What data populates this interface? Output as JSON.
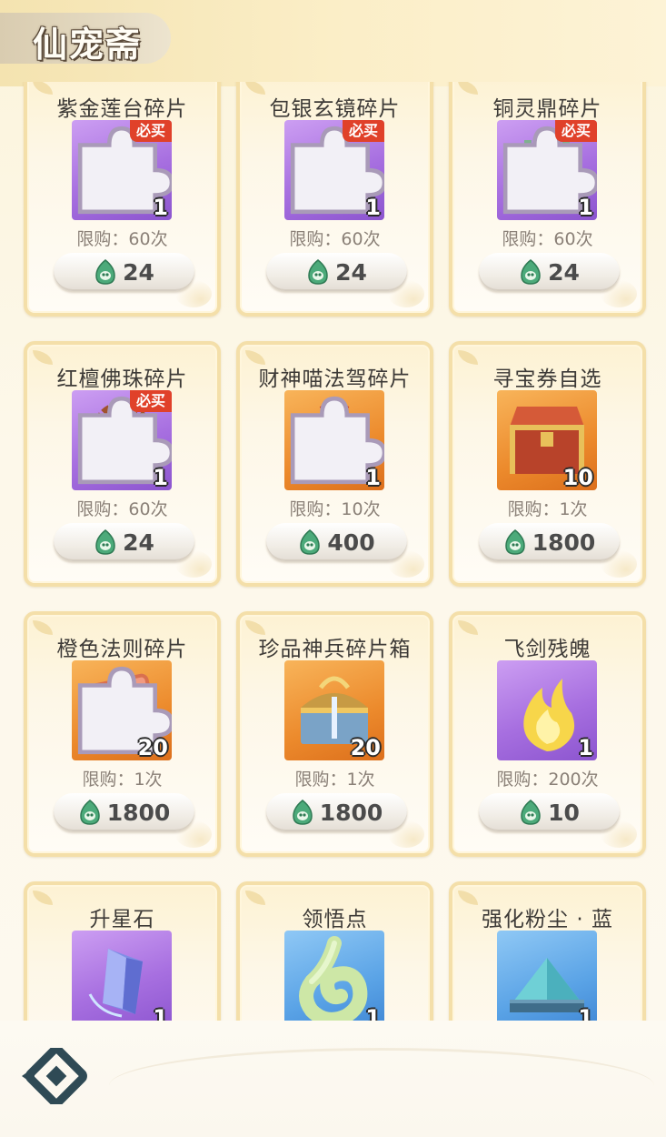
{
  "header": {
    "title": "仙宠斋"
  },
  "colors": {
    "accent_red": "#e0412a",
    "card_border": "#f4dfa9"
  },
  "items": [
    {
      "name": "紫金莲台碎片",
      "qty": "1",
      "limit": "限购：60次",
      "price": "24",
      "badge": "必买",
      "fragment": true,
      "bg": "purple",
      "icon": "lotus-icon"
    },
    {
      "name": "包银玄镜碎片",
      "qty": "1",
      "limit": "限购：60次",
      "price": "24",
      "badge": "必买",
      "fragment": true,
      "bg": "purple",
      "icon": "mirror-icon"
    },
    {
      "name": "铜灵鼎碎片",
      "qty": "1",
      "limit": "限购：60次",
      "price": "24",
      "badge": "必买",
      "fragment": true,
      "bg": "purple",
      "icon": "cauldron-icon"
    },
    {
      "name": "红檀佛珠碎片",
      "qty": "1",
      "limit": "限购：60次",
      "price": "24",
      "badge": "必买",
      "fragment": true,
      "bg": "purple",
      "icon": "prayer-beads-icon"
    },
    {
      "name": "财神喵法驾碎片",
      "qty": "1",
      "limit": "限购：10次",
      "price": "400",
      "badge": "",
      "fragment": true,
      "bg": "orange",
      "icon": "lucky-cat-icon"
    },
    {
      "name": "寻宝券自选",
      "qty": "10",
      "limit": "限购：1次",
      "price": "1800",
      "badge": "",
      "fragment": false,
      "bg": "orange",
      "icon": "treasure-chest-icon"
    },
    {
      "name": "橙色法则碎片",
      "qty": "20",
      "limit": "限购：1次",
      "price": "1800",
      "badge": "",
      "fragment": true,
      "bg": "orange",
      "icon": "mystery-box-icon"
    },
    {
      "name": "珍品神兵碎片箱",
      "qty": "20",
      "limit": "限购：1次",
      "price": "1800",
      "badge": "",
      "fragment": false,
      "bg": "orange",
      "icon": "weapon-chest-icon"
    },
    {
      "name": "飞剑残魄",
      "qty": "1",
      "limit": "限购：200次",
      "price": "10",
      "badge": "",
      "fragment": false,
      "bg": "purple",
      "icon": "flame-icon"
    },
    {
      "name": "升星石",
      "qty": "1",
      "limit": "",
      "price": "",
      "badge": "",
      "fragment": false,
      "bg": "purple",
      "icon": "crystal-icon"
    },
    {
      "name": "领悟点",
      "qty": "1",
      "limit": "",
      "price": "",
      "badge": "",
      "fragment": false,
      "bg": "blue",
      "icon": "jade-swirl-icon"
    },
    {
      "name": "强化粉尘 · 蓝",
      "qty": "1",
      "limit": "",
      "price": "",
      "badge": "",
      "fragment": false,
      "bg": "blue",
      "icon": "dust-pile-icon"
    }
  ]
}
